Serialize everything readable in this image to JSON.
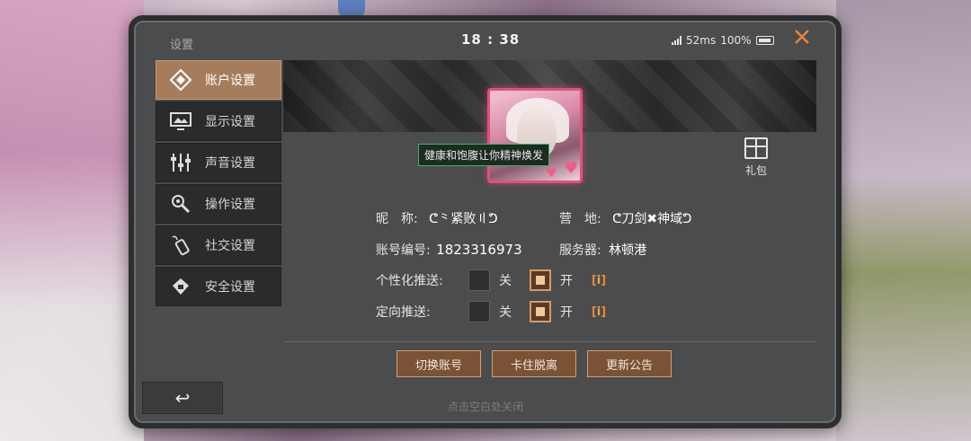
{
  "header": {
    "title": "设置",
    "time": "18 : 38",
    "ping": "52ms",
    "battery": "100%"
  },
  "sidebar": {
    "items": [
      {
        "label": "账户设置",
        "icon": "account-icon",
        "active": true
      },
      {
        "label": "显示设置",
        "icon": "display-icon",
        "active": false
      },
      {
        "label": "声音设置",
        "icon": "sound-icon",
        "active": false
      },
      {
        "label": "操作设置",
        "icon": "controls-icon",
        "active": false
      },
      {
        "label": "社交设置",
        "icon": "social-icon",
        "active": false
      },
      {
        "label": "安全设置",
        "icon": "security-icon",
        "active": false
      }
    ]
  },
  "profile": {
    "tooltip": "健康和饱腹让你精神焕发",
    "gift_label": "礼包",
    "nickname_label": "昵　称:",
    "nickname": "ᕦ⺀紧败〢ᕤ",
    "camp_label": "营　地:",
    "camp": "ᕦ刀剑✖神域ᕤ",
    "account_label": "账号编号:",
    "account_id": "1823316973",
    "server_label": "服务器:",
    "server": "林顿港"
  },
  "settings": {
    "personal_push_label": "个性化推送:",
    "targeted_push_label": "定向推送:",
    "off_label": "关",
    "on_label": "开",
    "info_label": "i",
    "personal_push_on": true,
    "targeted_push_on": true
  },
  "buttons": {
    "switch_account": "切换账号",
    "unstuck": "卡住脱离",
    "announcement": "更新公告"
  },
  "footer": {
    "hint": "点击空白处关闭",
    "back_symbol": "↩"
  },
  "colors": {
    "accent": "#a67d5c",
    "close": "#e9853a",
    "button": "#7a5337"
  }
}
